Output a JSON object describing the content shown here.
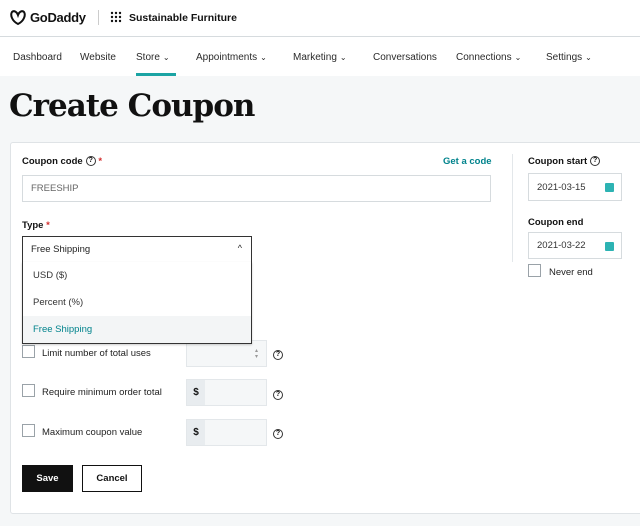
{
  "header": {
    "brand": "GoDaddy",
    "site_name": "Sustainable Furniture"
  },
  "nav": [
    {
      "label": "Dashboard"
    },
    {
      "label": "Website"
    },
    {
      "label": "Store",
      "active": true
    },
    {
      "label": "Appointments"
    },
    {
      "label": "Marketing"
    },
    {
      "label": "Conversations"
    },
    {
      "label": "Connections"
    },
    {
      "label": "Settings"
    }
  ],
  "page_title": "Create Coupon",
  "form": {
    "coupon_code_label": "Coupon code",
    "required": "*",
    "get_code": "Get a code",
    "coupon_code_value": "FREESHIP",
    "type_label": "Type",
    "type_value": "Free Shipping",
    "type_options": [
      "USD ($)",
      "Percent (%)",
      "Free Shipping"
    ],
    "limit_label": "Limit number of total uses",
    "min_order_label": "Require minimum order total",
    "max_value_label": "Maximum coupon value",
    "currency": "$",
    "save": "Save",
    "cancel": "Cancel",
    "start_label": "Coupon start",
    "start_value": "2021-03-15",
    "end_label": "Coupon end",
    "end_value": "2021-03-22",
    "never_end": "Never end"
  },
  "colors": {
    "accent": "#00838c",
    "active_underline": "#1ba4a4"
  }
}
